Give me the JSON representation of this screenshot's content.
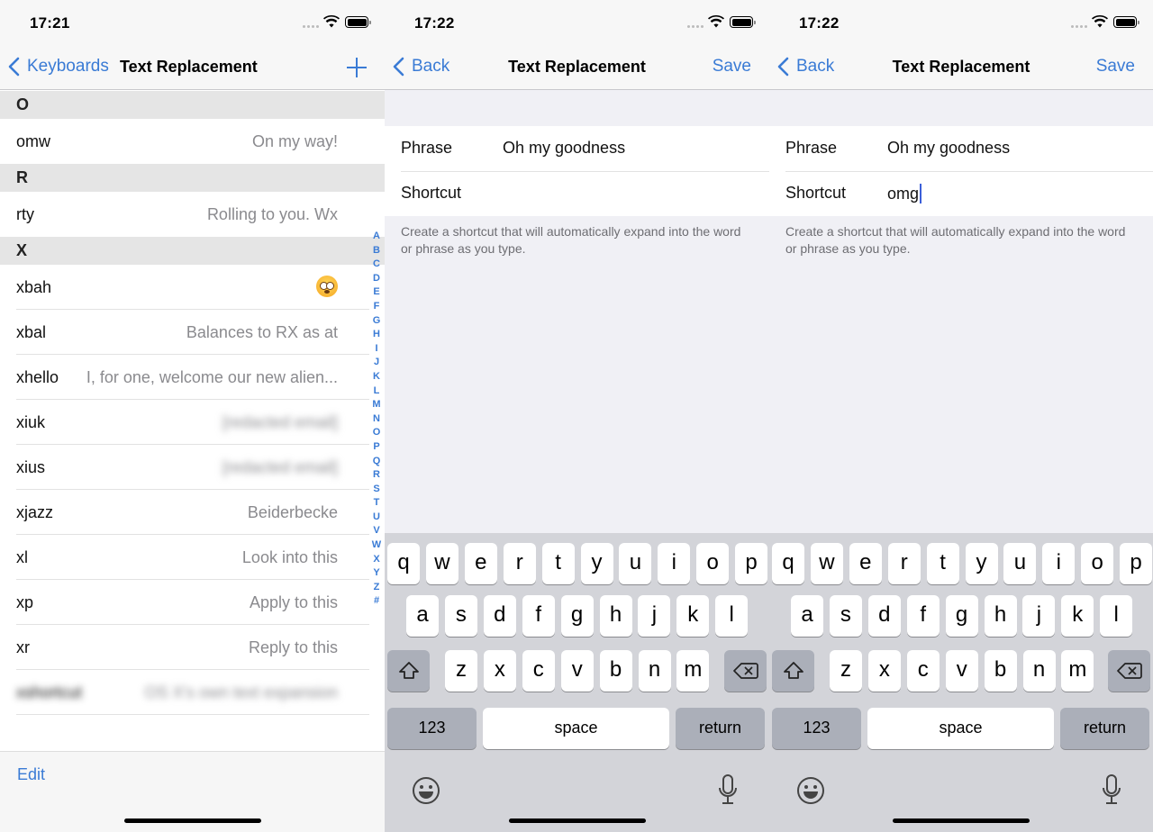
{
  "screens": [
    {
      "status": {
        "time": "17:21"
      },
      "nav": {
        "back_label": "Keyboards",
        "title": "Text Replacement",
        "action_icon": "plus-icon"
      },
      "sections": [
        {
          "header": "O",
          "items": [
            {
              "shortcut": "omw",
              "phrase": "On my way!"
            }
          ]
        },
        {
          "header": "R",
          "items": [
            {
              "shortcut": "rty",
              "phrase": "Rolling to you. Wx"
            }
          ]
        },
        {
          "header": "X",
          "items": [
            {
              "shortcut": "xbah",
              "phrase": "😳"
            },
            {
              "shortcut": "xbal",
              "phrase": "Balances to RX as at"
            },
            {
              "shortcut": "xhello",
              "phrase": "I, for one, welcome our new alien..."
            },
            {
              "shortcut": "xiuk",
              "phrase": "[redacted email]",
              "blurred": true
            },
            {
              "shortcut": "xius",
              "phrase": "[redacted email]",
              "blurred": true
            },
            {
              "shortcut": "xjazz",
              "phrase": "Beiderbecke"
            },
            {
              "shortcut": "xl",
              "phrase": "Look into this"
            },
            {
              "shortcut": "xp",
              "phrase": "Apply to this"
            },
            {
              "shortcut": "xr",
              "phrase": "Reply to this"
            },
            {
              "shortcut": "xshortcut",
              "phrase": "OS X's own text expansion",
              "blurred": true
            }
          ]
        }
      ],
      "index": [
        "A",
        "B",
        "C",
        "D",
        "E",
        "F",
        "G",
        "H",
        "I",
        "J",
        "K",
        "L",
        "M",
        "N",
        "O",
        "P",
        "Q",
        "R",
        "S",
        "T",
        "U",
        "V",
        "W",
        "X",
        "Y",
        "Z",
        "#"
      ],
      "toolbar": {
        "edit_label": "Edit"
      }
    },
    {
      "status": {
        "time": "17:22"
      },
      "nav": {
        "back_label": "Back",
        "title": "Text Replacement",
        "save_label": "Save"
      },
      "form": {
        "phrase_label": "Phrase",
        "phrase_value": "Oh my goodness",
        "shortcut_label": "Shortcut",
        "shortcut_value": ""
      },
      "footnote": "Create a shortcut that will automatically expand into the word or phrase as you type."
    },
    {
      "status": {
        "time": "17:22"
      },
      "nav": {
        "back_label": "Back",
        "title": "Text Replacement",
        "save_label": "Save"
      },
      "form": {
        "phrase_label": "Phrase",
        "phrase_value": "Oh my goodness",
        "shortcut_label": "Shortcut",
        "shortcut_value": "omg"
      },
      "footnote": "Create a shortcut that will automatically expand into the word or phrase as you type."
    }
  ],
  "keyboard": {
    "row1": [
      "q",
      "w",
      "e",
      "r",
      "t",
      "y",
      "u",
      "i",
      "o",
      "p"
    ],
    "row2": [
      "a",
      "s",
      "d",
      "f",
      "g",
      "h",
      "j",
      "k",
      "l"
    ],
    "row3": [
      "z",
      "x",
      "c",
      "v",
      "b",
      "n",
      "m"
    ],
    "numbers_label": "123",
    "space_label": "space",
    "return_label": "return",
    "shift_icon": "shift-icon",
    "delete_icon": "delete-icon",
    "emoji_icon": "emoji-icon",
    "mic_icon": "microphone-icon"
  },
  "colors": {
    "accent": "#3a7bd5",
    "caret": "#3b5fd9",
    "keyboard_bg": "#d3d4d9",
    "function_key": "#abafb9"
  }
}
